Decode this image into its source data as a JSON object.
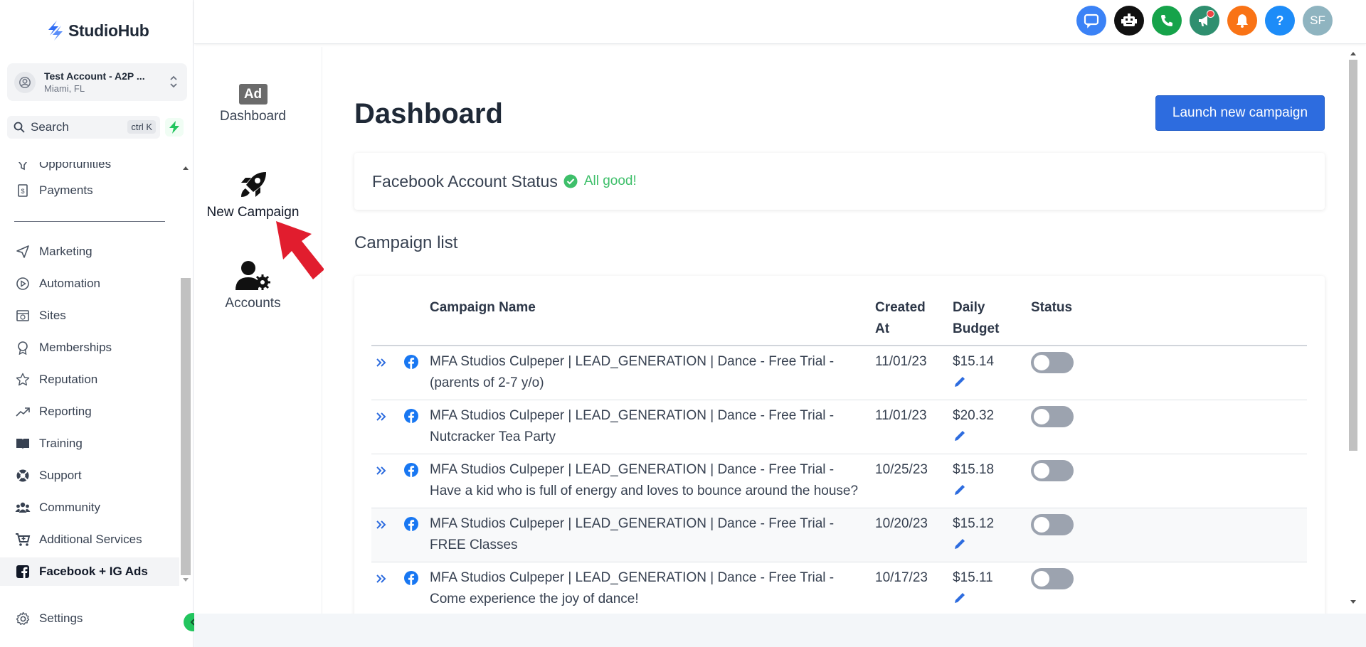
{
  "brand": {
    "name": "StudioHub"
  },
  "account": {
    "name": "Test Account - A2P ...",
    "location": "Miami, FL"
  },
  "search": {
    "label": "Search",
    "shortcut": "ctrl K"
  },
  "sidebar": {
    "partial_item": "Opportunities",
    "items": [
      {
        "label": "Payments",
        "icon": "receipt-icon"
      },
      {
        "label": "Marketing",
        "icon": "send-icon"
      },
      {
        "label": "Automation",
        "icon": "play-circle-icon"
      },
      {
        "label": "Sites",
        "icon": "globe-icon"
      },
      {
        "label": "Memberships",
        "icon": "award-icon"
      },
      {
        "label": "Reputation",
        "icon": "star-icon"
      },
      {
        "label": "Reporting",
        "icon": "trend-up-icon"
      },
      {
        "label": "Training",
        "icon": "book-icon"
      },
      {
        "label": "Support",
        "icon": "lifebuoy-icon"
      },
      {
        "label": "Community",
        "icon": "users-icon"
      },
      {
        "label": "Additional Services",
        "icon": "cart-icon"
      },
      {
        "label": "Facebook + IG Ads",
        "icon": "facebook-icon"
      }
    ],
    "settings": "Settings"
  },
  "topbar": {
    "avatar_initials": "SF",
    "help": "?",
    "colors": [
      "#3b82f6",
      "#111111",
      "#16a34a",
      "#2f8f6f",
      "#f97316",
      "#1d8cf8",
      "#8fb4c0"
    ]
  },
  "subnav": {
    "dashboard": "Dashboard",
    "dashboard_badge": "Ad",
    "new_campaign": "New Campaign",
    "accounts": "Accounts"
  },
  "main": {
    "title": "Dashboard",
    "launch_button": "Launch new campaign",
    "status_label": "Facebook Account Status",
    "status_value": "All good!",
    "campaign_list_title": "Campaign list"
  },
  "table": {
    "headers": {
      "name": "Campaign Name",
      "created": "Created At",
      "budget": "Daily Budget",
      "status": "Status"
    },
    "rows": [
      {
        "name": "MFA Studios Culpeper | LEAD_GENERATION | Dance - Free Trial - (parents of 2-7 y/o)",
        "created": "11/01/23",
        "budget": "$15.14"
      },
      {
        "name": "MFA Studios Culpeper | LEAD_GENERATION | Dance - Free Trial - Nutcracker Tea Party",
        "created": "11/01/23",
        "budget": "$20.32"
      },
      {
        "name": "MFA Studios Culpeper | LEAD_GENERATION | Dance - Free Trial - Have a kid who is full of energy and loves to bounce around the house?",
        "created": "10/25/23",
        "budget": "$15.18"
      },
      {
        "name": "MFA Studios Culpeper | LEAD_GENERATION | Dance - Free Trial - FREE Classes",
        "created": "10/20/23",
        "budget": "$15.12"
      },
      {
        "name": "MFA Studios Culpeper | LEAD_GENERATION | Dance - Free Trial - Come experience the joy of dance!",
        "created": "10/17/23",
        "budget": "$15.11"
      }
    ]
  }
}
